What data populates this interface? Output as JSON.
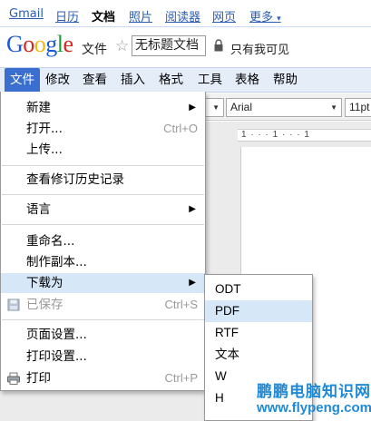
{
  "gbar": {
    "items": [
      {
        "label": "Gmail",
        "active": false
      },
      {
        "label": "日历",
        "active": false
      },
      {
        "label": "文档",
        "active": true
      },
      {
        "label": "照片",
        "active": false
      },
      {
        "label": "阅读器",
        "active": false
      },
      {
        "label": "网页",
        "active": false
      },
      {
        "label": "更多",
        "active": false
      }
    ],
    "more_arrow": "▾"
  },
  "header": {
    "logo": {
      "G": "G",
      "o1": "o",
      "o2": "o",
      "g": "g",
      "l": "l",
      "e": "e"
    },
    "docs_word": "文件",
    "star": "☆",
    "doc_title": "无标题文档",
    "share_text": "只有我可见"
  },
  "menubar": {
    "items": [
      "文件",
      "修改",
      "查看",
      "插入",
      "格式",
      "工具",
      "表格",
      "帮助"
    ]
  },
  "toolbar": {
    "font": "Arial",
    "size": "11pt"
  },
  "ruler": {
    "text": "1 · · · 1 · · · 1"
  },
  "file_menu": {
    "new": {
      "label": "新建",
      "submenu": "▶"
    },
    "open": {
      "label": "打开...",
      "shortcut": "Ctrl+O"
    },
    "upload": {
      "label": "上传..."
    },
    "revision_history": {
      "label": "查看修订历史记录"
    },
    "language": {
      "label": "语言",
      "submenu": "▶"
    },
    "rename": {
      "label": "重命名..."
    },
    "make_copy": {
      "label": "制作副本..."
    },
    "download_as": {
      "label": "下载为",
      "submenu": "▶"
    },
    "saved": {
      "label": "已保存",
      "shortcut": "Ctrl+S"
    },
    "page_setup": {
      "label": "页面设置..."
    },
    "print_settings": {
      "label": "打印设置..."
    },
    "print": {
      "label": "打印",
      "shortcut": "Ctrl+P"
    }
  },
  "download_submenu": {
    "items": [
      "ODT",
      "PDF",
      "RTF",
      "文本",
      "W",
      "H"
    ]
  },
  "watermark": {
    "line1": "鹏鹏电脑知识网",
    "line2": "www.flypeng.com"
  },
  "colors": {
    "accent": "#3a6fd0",
    "highlight": "#d6e7f7",
    "menubar_bg": "#e5edf9",
    "watermark": "#1e8ad6"
  }
}
